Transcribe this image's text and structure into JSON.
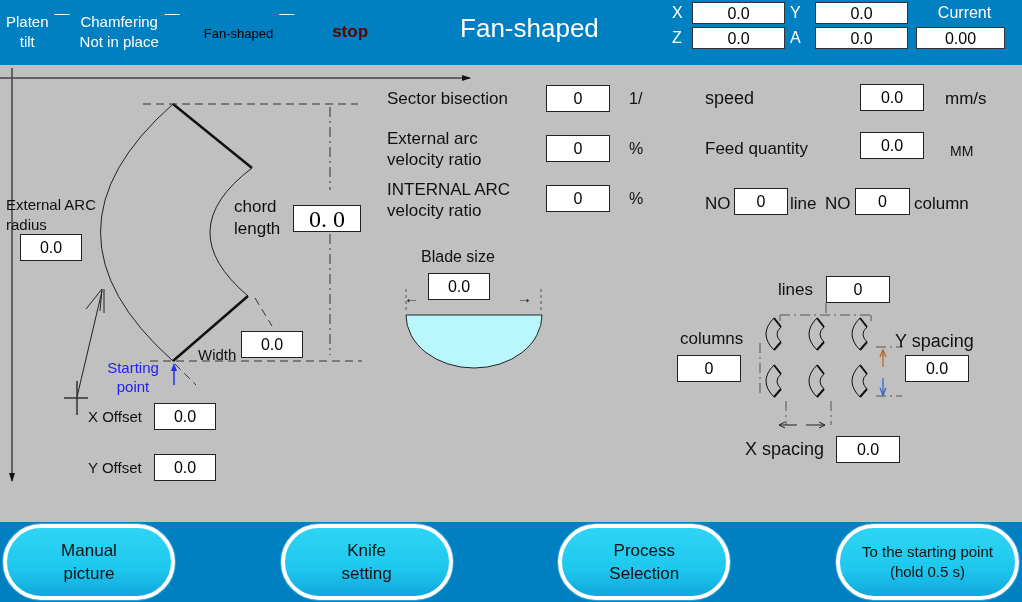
{
  "header": {
    "status": [
      {
        "kind": "status",
        "lines": [
          "Platen",
          "tilt"
        ],
        "indicator": "—"
      },
      {
        "kind": "status",
        "lines": [
          "Chamfering",
          "Not in place"
        ],
        "indicator": "—"
      },
      {
        "kind": "mode",
        "lines": [
          "Fan-shaped"
        ],
        "indicator": "—"
      },
      {
        "kind": "alarm",
        "lines": [
          "stop"
        ]
      }
    ],
    "title": "Fan-shaped",
    "axes": [
      {
        "label": "X",
        "value": "0.0"
      },
      {
        "label": "Y",
        "value": "0.0"
      },
      {
        "label": "Z",
        "value": "0.0"
      },
      {
        "label": "A",
        "value": "0.0"
      }
    ],
    "current": {
      "label": "Current",
      "value": "0.00"
    }
  },
  "diagram": {
    "external_arc_radius": {
      "label": "External ARC radius",
      "value": "0.0"
    },
    "chord_length": {
      "label": "chord length",
      "value": "0. 0"
    },
    "width": {
      "label": "Width",
      "value": "0.0"
    },
    "starting_point": "Starting point",
    "x_offset": {
      "label": "X Offset",
      "value": "0.0"
    },
    "y_offset": {
      "label": "Y Offset",
      "value": "0.0"
    }
  },
  "params": [
    {
      "label": "Sector bisection",
      "value": "0",
      "unit": "1/"
    },
    {
      "label": "External arc velocity ratio",
      "value": "0",
      "unit": "%"
    },
    {
      "label": "INTERNAL ARC velocity ratio",
      "value": "0",
      "unit": "%"
    }
  ],
  "motion": [
    {
      "label": "speed",
      "value": "0.0",
      "unit": "mm/s"
    },
    {
      "label": "Feed quantity",
      "value": "0.0",
      "unit": "MM"
    }
  ],
  "position": {
    "row_prefix": "NO",
    "row": "0",
    "row_unit": "line",
    "col_prefix": "NO",
    "col": "0",
    "col_unit": "column"
  },
  "blade": {
    "label": "Blade size",
    "value": "0.0",
    "left_arrow": "←",
    "right_arrow": "→"
  },
  "array": {
    "lines": {
      "label": "lines",
      "value": "0"
    },
    "columns": {
      "label": "columns",
      "value": "0"
    },
    "y_spacing": {
      "label": "Y spacing",
      "value": "0.0"
    },
    "x_spacing": {
      "label": "X spacing",
      "value": "0.0"
    }
  },
  "buttons": [
    {
      "lines": [
        "Manual",
        "picture"
      ]
    },
    {
      "lines": [
        "Knife",
        "setting"
      ]
    },
    {
      "lines": [
        "Process",
        "Selection"
      ]
    },
    {
      "lines": [
        "To the starting point",
        "(hold 0.5 s)"
      ],
      "kind": "small"
    }
  ]
}
